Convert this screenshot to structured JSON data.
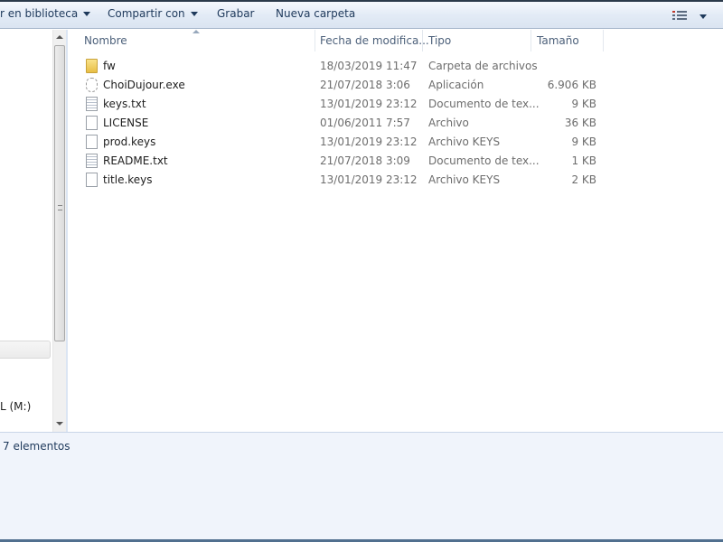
{
  "toolbar": {
    "include_library": "r en biblioteca",
    "share_with": "Compartir con",
    "burn": "Grabar",
    "new_folder": "Nueva carpeta"
  },
  "nav": {
    "drive_label": "L (M:)"
  },
  "columns": {
    "name": "Nombre",
    "date": "Fecha de modifica...",
    "type": "Tipo",
    "size": "Tamaño"
  },
  "files": [
    {
      "icon": "folder-icon",
      "name": "fw",
      "date": "18/03/2019 11:47",
      "type": "Carpeta de archivos",
      "size": ""
    },
    {
      "icon": "exe-icon",
      "name": "ChoiDujour.exe",
      "date": "21/07/2018 3:06",
      "type": "Aplicación",
      "size": "6.906 KB"
    },
    {
      "icon": "text-file-icon",
      "name": "keys.txt",
      "date": "13/01/2019 23:12",
      "type": "Documento de tex...",
      "size": "9 KB"
    },
    {
      "icon": "file-icon",
      "name": "LICENSE",
      "date": "01/06/2011 7:57",
      "type": "Archivo",
      "size": "36 KB"
    },
    {
      "icon": "file-icon",
      "name": "prod.keys",
      "date": "13/01/2019 23:12",
      "type": "Archivo KEYS",
      "size": "9 KB"
    },
    {
      "icon": "text-file-icon",
      "name": "README.txt",
      "date": "21/07/2018 3:09",
      "type": "Documento de tex...",
      "size": "1 KB"
    },
    {
      "icon": "file-icon",
      "name": "title.keys",
      "date": "13/01/2019 23:12",
      "type": "Archivo KEYS",
      "size": "2 KB"
    }
  ],
  "status": {
    "count": "7 elementos"
  }
}
